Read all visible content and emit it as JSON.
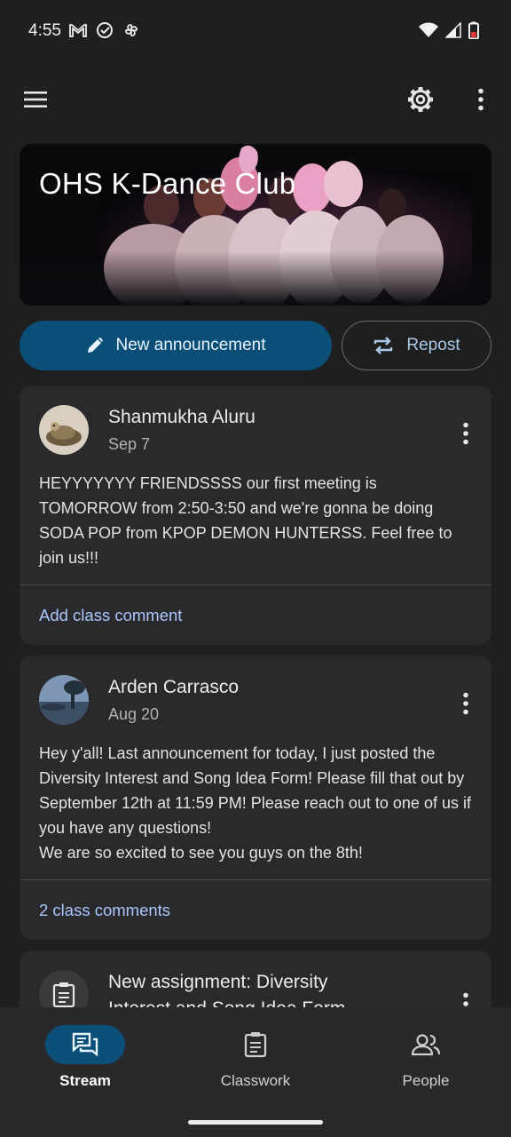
{
  "status": {
    "time": "4:55"
  },
  "class": {
    "title": "OHS K-Dance Club"
  },
  "actions": {
    "announce_label": "New announcement",
    "repost_label": "Repost"
  },
  "posts": [
    {
      "author": "Shanmukha Aluru",
      "date": "Sep 7",
      "text": "HEYYYYYYY FRIENDSSSS our first meeting is TOMORROW from 2:50-3:50 and we're gonna be doing SODA POP from KPOP DEMON HUNTERSS. Feel free to join us!!!",
      "comment_label": "Add class comment"
    },
    {
      "author": "Arden Carrasco",
      "date": "Aug 20",
      "text": "Hey y'all! Last announcement for today, I just posted the Diversity Interest and Song Idea Form! Please fill that out by September 12th at 11:59 PM! Please reach out to one of us if you have any questions!\nWe are so excited to see you guys on the 8th!",
      "comment_label": "2 class comments"
    },
    {
      "title": "New assignment: Diversity",
      "title_line2": "Interest and Song Idea Form"
    }
  ],
  "nav": {
    "stream": "Stream",
    "classwork": "Classwork",
    "people": "People"
  },
  "colors": {
    "accent": "#0b4f78",
    "link": "#a9c7ff",
    "background": "#1f1f20",
    "card": "#2a2a2c"
  },
  "icons": [
    "gmail-icon",
    "check-circle-icon",
    "pinwheel-icon",
    "wifi-icon",
    "signal-icon",
    "battery-icon",
    "menu-icon",
    "gear-icon",
    "more-vert-icon",
    "pencil-icon",
    "repost-icon",
    "assignment-icon",
    "stream-icon",
    "classwork-icon",
    "people-icon"
  ]
}
